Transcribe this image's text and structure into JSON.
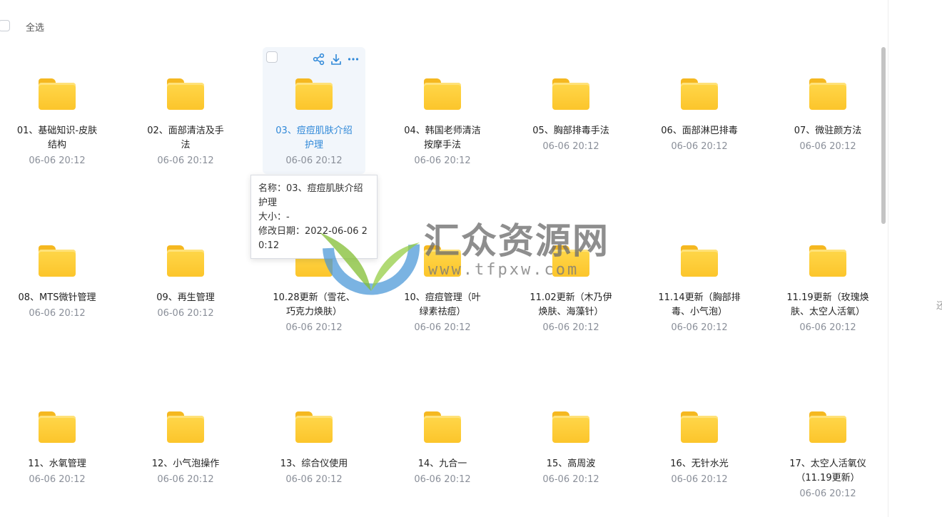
{
  "toolbar": {
    "select_all_label": "全选"
  },
  "files": [
    {
      "name": "01、基础知识-皮肤结构",
      "date": "06-06 20:12"
    },
    {
      "name": "02、面部清洁及手法",
      "date": "06-06 20:12"
    },
    {
      "name": "03、痘痘肌肤介绍护理",
      "date": "06-06 20:12"
    },
    {
      "name": "04、韩国老师清洁按摩手法",
      "date": "06-06 20:12"
    },
    {
      "name": "05、胸部排毒手法",
      "date": "06-06 20:12"
    },
    {
      "name": "06、面部淋巴排毒",
      "date": "06-06 20:12"
    },
    {
      "name": "07、微驻颜方法",
      "date": "06-06 20:12"
    },
    {
      "name": "08、MTS微针管理",
      "date": "06-06 20:12"
    },
    {
      "name": "09、再生管理",
      "date": "06-06 20:12"
    },
    {
      "name": "10.28更新（雪花、巧克力焕肤）",
      "date": "06-06 20:12"
    },
    {
      "name": "10、痘痘管理（叶绿素祛痘）",
      "date": "06-06 20:12"
    },
    {
      "name": "11.02更新（木乃伊焕肤、海藻针）",
      "date": "06-06 20:12"
    },
    {
      "name": "11.14更新（胸部排毒、小气泡）",
      "date": "06-06 20:12"
    },
    {
      "name": "11.19更新（玫瑰焕肤、太空人活氧）",
      "date": "06-06 20:12"
    },
    {
      "name": "11、水氧管理",
      "date": "06-06 20:12"
    },
    {
      "name": "12、小气泡操作",
      "date": "06-06 20:12"
    },
    {
      "name": "13、综合仪使用",
      "date": "06-06 20:12"
    },
    {
      "name": "14、九合一",
      "date": "06-06 20:12"
    },
    {
      "name": "15、高周波",
      "date": "06-06 20:12"
    },
    {
      "name": "16、无针水光",
      "date": "06-06 20:12"
    },
    {
      "name": "17、太空人活氧仪（11.19更新）",
      "date": "06-06 20:12"
    }
  ],
  "hovered_index": 2,
  "tooltip": {
    "name_line": "名称：03、痘痘肌肤介绍护理",
    "size_line": "大小：-",
    "modified_line": "修改日期：2022-06-06 20:12"
  },
  "watermark": {
    "text": "汇众资源网",
    "url": "www.tfpxw.com"
  },
  "right_edge_char": "还",
  "colors": {
    "folder": "#fcc52b",
    "accent": "#2f88d8",
    "hover_bg": "#f2f6fb"
  }
}
